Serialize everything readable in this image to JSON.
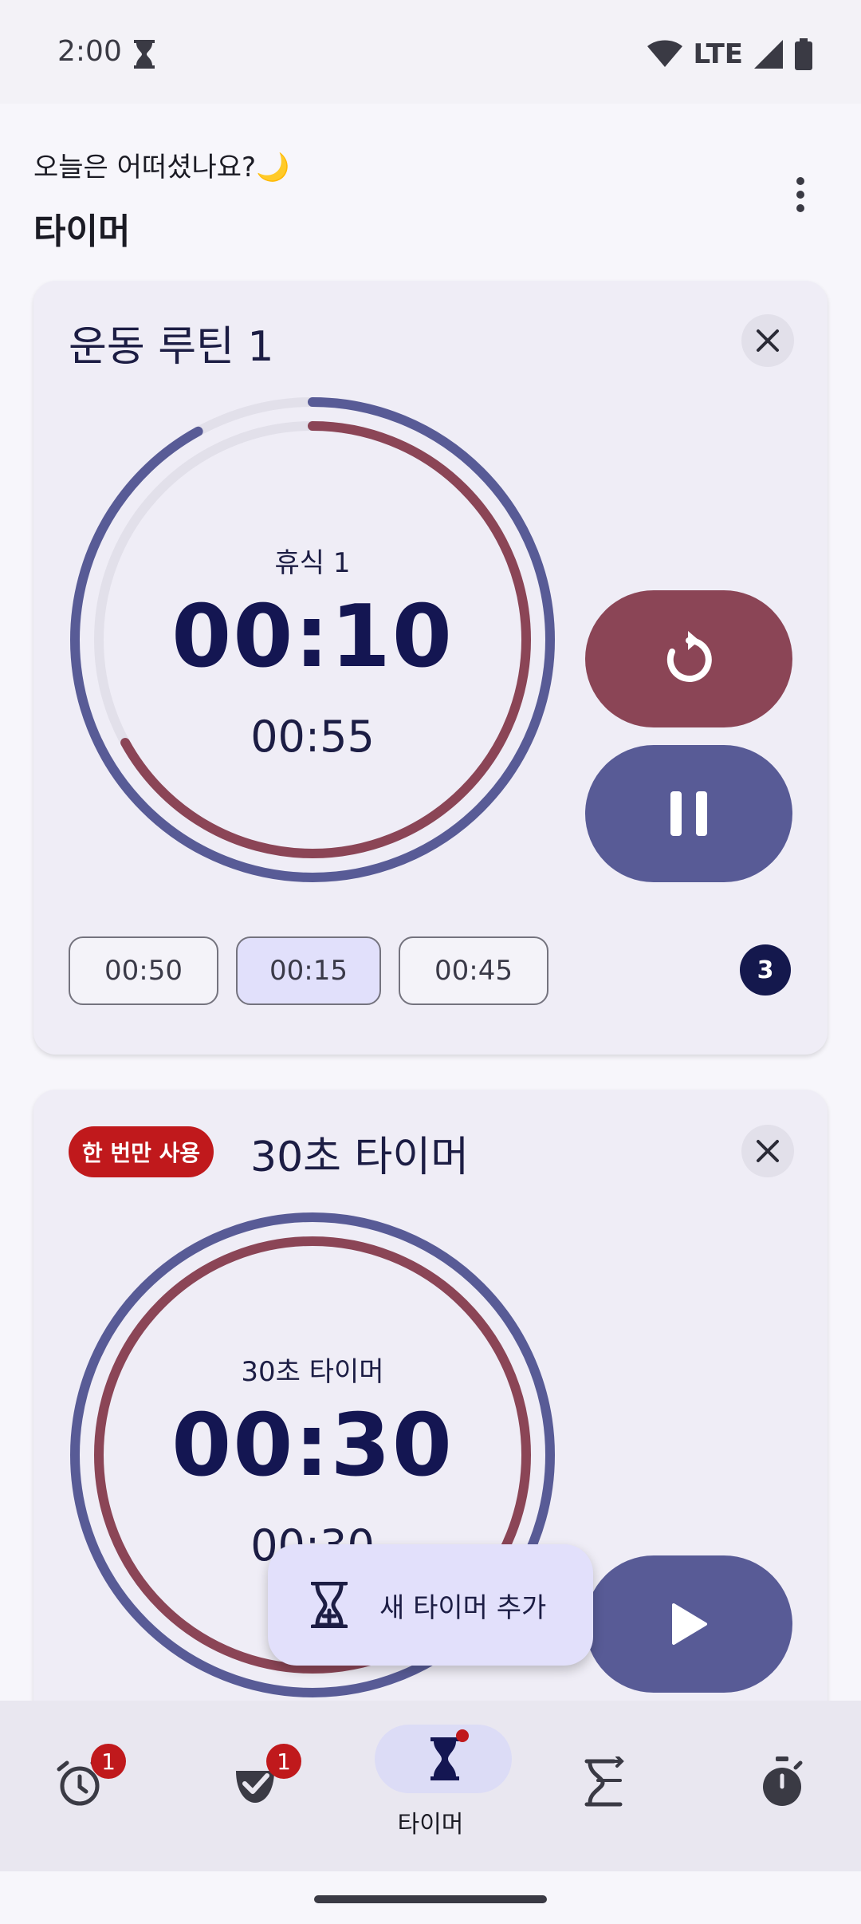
{
  "status_bar": {
    "time": "2:00",
    "network": "LTE",
    "icons": [
      "hourglass-icon",
      "wifi-icon",
      "signal-icon",
      "battery-icon"
    ]
  },
  "header": {
    "greeting": "오늘은 어떠셨나요?🌙",
    "title": "타이머",
    "menu_icon": "more-vert-icon"
  },
  "timers": [
    {
      "title": "운동 루틴 1",
      "phase_label": "휴식 1",
      "remaining": "00:10",
      "total_remaining": "00:55",
      "outer_progress": 0.92,
      "inner_progress": 0.67,
      "reset_icon": "reset-icon",
      "pause_icon": "pause-icon",
      "steps": [
        "00:50",
        "00:15",
        "00:45"
      ],
      "selected_step": 1,
      "round_count": "3"
    },
    {
      "badge": "한 번만 사용",
      "title": "30초 타이머",
      "phase_label": "30초 타이머",
      "remaining": "00:30",
      "total_remaining": "00:30",
      "outer_progress": 1.0,
      "inner_progress": 1.0,
      "play_icon": "play-icon"
    }
  ],
  "fab": {
    "label": "새 타이머 추가",
    "icon": "add-timer-icon"
  },
  "bottom_nav": {
    "items": [
      {
        "icon": "alarm-icon",
        "badge": "1"
      },
      {
        "icon": "task-check-icon",
        "badge": "1"
      },
      {
        "icon": "hourglass-icon",
        "label": "타이머",
        "active": true
      },
      {
        "icon": "repeat-timer-icon"
      },
      {
        "icon": "stopwatch-icon"
      }
    ]
  },
  "colors": {
    "accent_blue": "#585b96",
    "accent_red": "#8b4556",
    "badge_red": "#c0191c",
    "card_bg": "#efedf6",
    "text_dark": "#141652"
  }
}
